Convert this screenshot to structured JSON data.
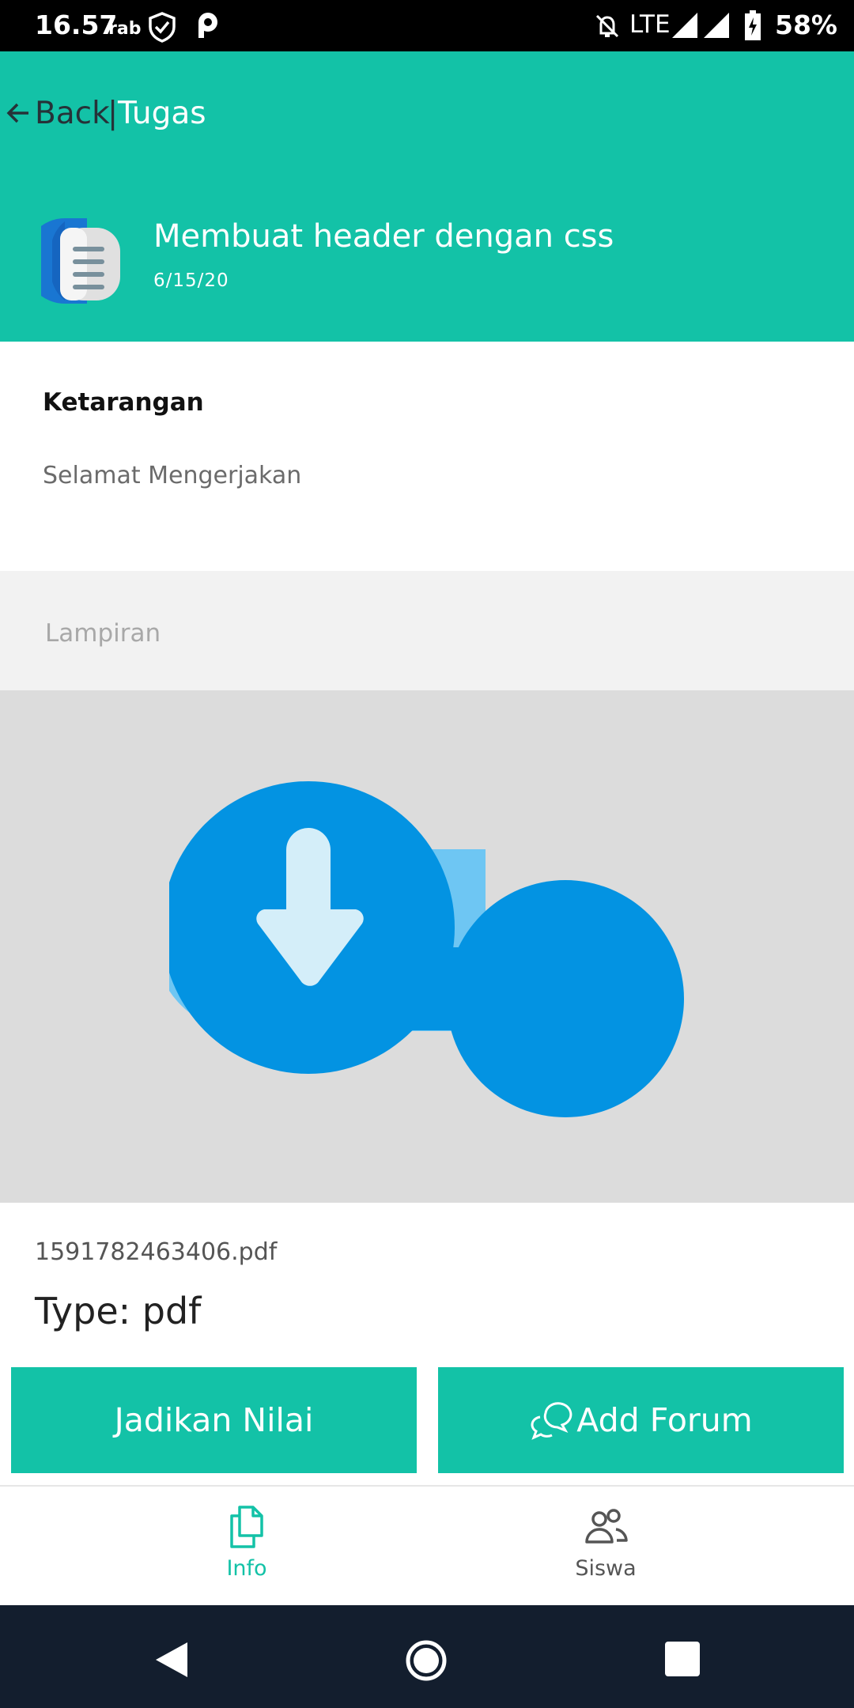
{
  "status_bar": {
    "time": "16.57",
    "day": "rab",
    "network": "LTE",
    "battery": "58%"
  },
  "header": {
    "back_label": "Back",
    "separator": "|",
    "title": "Tugas",
    "background_color": "#13c2a7"
  },
  "task": {
    "title": "Membuat header dengan css",
    "date": "6/15/20",
    "icon": "document-icon"
  },
  "description": {
    "heading": "Ketarangan",
    "text": "Selamat Mengerjakan"
  },
  "attachment": {
    "section_label": "Lampiran",
    "icon": "cloud-download-icon",
    "file_name": "1591782463406.pdf",
    "file_type": "Type: pdf"
  },
  "actions": {
    "grade_label": "Jadikan Nilai",
    "forum_label": "Add Forum"
  },
  "bottom_nav": {
    "items": [
      {
        "label": "Info",
        "icon": "files-icon",
        "active": true
      },
      {
        "label": "Siswa",
        "icon": "users-icon",
        "active": false
      }
    ]
  },
  "accent_color": "#13c2a7"
}
